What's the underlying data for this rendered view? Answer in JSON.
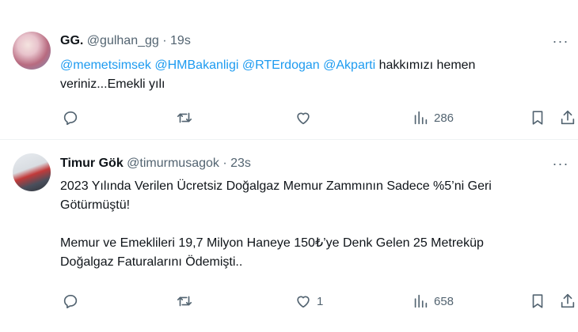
{
  "tweets": [
    {
      "name": "GG.",
      "handle": "@gulhan_gg",
      "separator": "·",
      "time": "19s",
      "more": "···",
      "mentions": [
        "@memetsimsek",
        "@HMBakanligi",
        "@RTErdogan",
        "@Akparti"
      ],
      "text_line1_rest": "hakkımızı hemen",
      "text_line2": "veriniz...Emekli yılı",
      "reply_count": "",
      "retweet_count": "",
      "like_count": "",
      "view_count": "286"
    },
    {
      "name": "Timur Gök",
      "handle": "@timurmusagok",
      "separator": "·",
      "time": "23s",
      "more": "···",
      "para1_line1": "2023 Yılında Verilen Ücretsiz Doğalgaz Memur Zammının Sadece %5’ni Geri",
      "para1_line2": "Götürmüştü!",
      "para2_line1": "Memur ve Emeklileri 19,7 Milyon Haneye 150₺’ye Denk Gelen 25 Metreküp",
      "para2_line2": "Doğalgaz Faturalarını Ödemişti..",
      "reply_count": "",
      "retweet_count": "",
      "like_count": "1",
      "view_count": "658"
    }
  ],
  "colors": {
    "link": "#1d9bf0",
    "text": "#0f1419",
    "muted": "#536471",
    "divider": "#eff3f4"
  },
  "icons": [
    "reply-icon",
    "retweet-icon",
    "like-icon",
    "views-icon",
    "bookmark-icon",
    "share-icon",
    "more-icon"
  ]
}
